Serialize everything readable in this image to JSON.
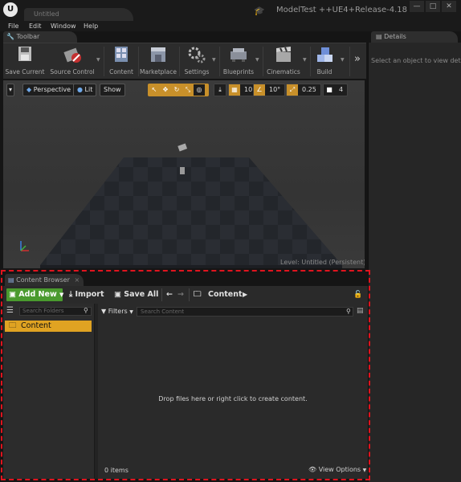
{
  "window": {
    "doc_tab_label": "Untitled",
    "project_name": "ModelTest ++UE4+Release-4.18",
    "min_glyph": "—",
    "max_glyph": "□",
    "close_glyph": "✕"
  },
  "menu": [
    "File",
    "Edit",
    "Window",
    "Help"
  ],
  "toolbar": {
    "tab_label": "Toolbar",
    "buttons": [
      {
        "label": "Save Current",
        "icon": "floppy-disk-icon"
      },
      {
        "label": "Source Control",
        "icon": "source-control-icon"
      },
      {
        "label": "Content",
        "icon": "content-icon"
      },
      {
        "label": "Marketplace",
        "icon": "marketplace-icon"
      },
      {
        "label": "Settings",
        "icon": "gears-icon"
      },
      {
        "label": "Blueprints",
        "icon": "blueprints-icon"
      },
      {
        "label": "Cinematics",
        "icon": "clapperboard-icon"
      },
      {
        "label": "Build",
        "icon": "build-cubes-icon"
      }
    ],
    "expand_glyph": "»"
  },
  "details": {
    "tab_label": "Details",
    "empty_message": "Select an object to view details"
  },
  "viewport": {
    "perspective_label": "Perspective",
    "lit_label": "Lit",
    "show_label": "Show",
    "grid_snap_value": "10",
    "rotation_snap_value": "10°",
    "scale_snap_value": "0.25",
    "camera_speed_value": "4",
    "level_label": "Level:  Untitled (Persistent)"
  },
  "content_browser": {
    "tab_label": "Content Browser",
    "add_new_label": "Add New",
    "import_label": "Import",
    "save_all_label": "Save All",
    "path_label": "Content",
    "folders_search_placeholder": "Search Folders",
    "folders": [
      "Content"
    ],
    "filters_label": "Filters",
    "content_search_placeholder": "Search Content",
    "empty_message": "Drop files here or right click to create content.",
    "item_count": "0 items",
    "view_options_label": "View Options"
  },
  "colors": {
    "add_new_green": "#4a9a2e",
    "selected_folder": "#e0a322",
    "snap_orange": "#c8902a",
    "highlight_border": "#e0141e"
  }
}
